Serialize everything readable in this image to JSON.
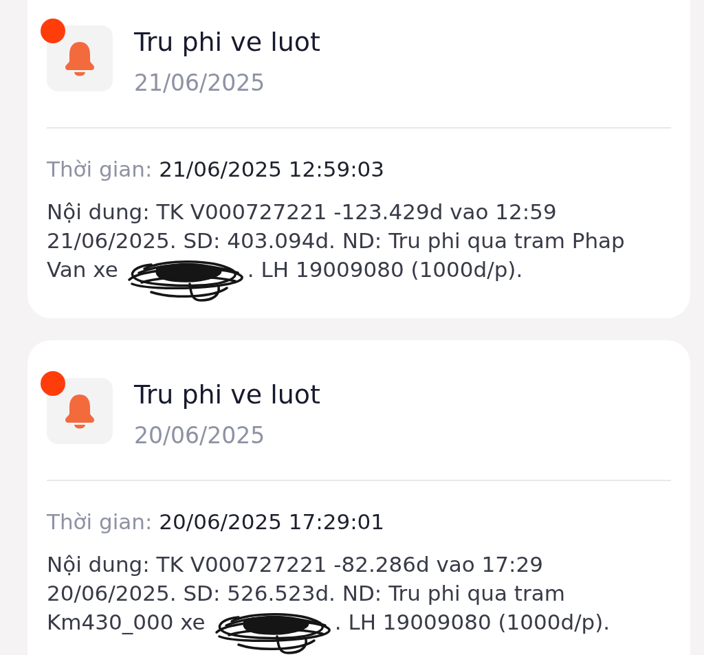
{
  "notifications": [
    {
      "title": "Tru phi ve luot",
      "date": "21/06/2025",
      "unread": true,
      "time_label": "Thời gian:",
      "time": "21/06/2025 12:59:03",
      "content": "Nội dung: TK V000727221 -123.429d vao 12:59 21/06/2025. SD: 403.094d. ND: Tru phi qua tram Phap",
      "line_start": "Van xe",
      "redacted": true,
      "line_end": ". LH 19009080 (1000d/p)."
    },
    {
      "title": "Tru phi ve luot",
      "date": "20/06/2025",
      "unread": true,
      "time_label": "Thời gian:",
      "time": "20/06/2025 17:29:01",
      "content": "Nội dung: TK V000727221 -82.286d vao 17:29 20/06/2025. SD: 526.523d. ND: Tru phi qua tram",
      "line_start": "Km430_000 xe",
      "redacted": true,
      "line_end": ". LH 19009080 (1000d/p)."
    }
  ]
}
